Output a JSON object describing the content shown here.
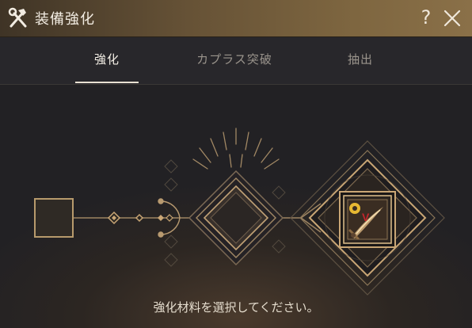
{
  "window": {
    "title": "装備強化",
    "help_label": "?"
  },
  "tabs": [
    {
      "label": "強化",
      "active": true
    },
    {
      "label": "カプラス突破",
      "active": false
    },
    {
      "label": "抽出",
      "active": false
    }
  ],
  "enhance": {
    "hint": "強化材料を選択してください。",
    "equipment_badge": "V"
  },
  "colors": {
    "accent_gold": "#c9a675",
    "title_bar": "#7e6640",
    "badge_yellow": "#e7b832",
    "badge_red": "#c0262c"
  }
}
